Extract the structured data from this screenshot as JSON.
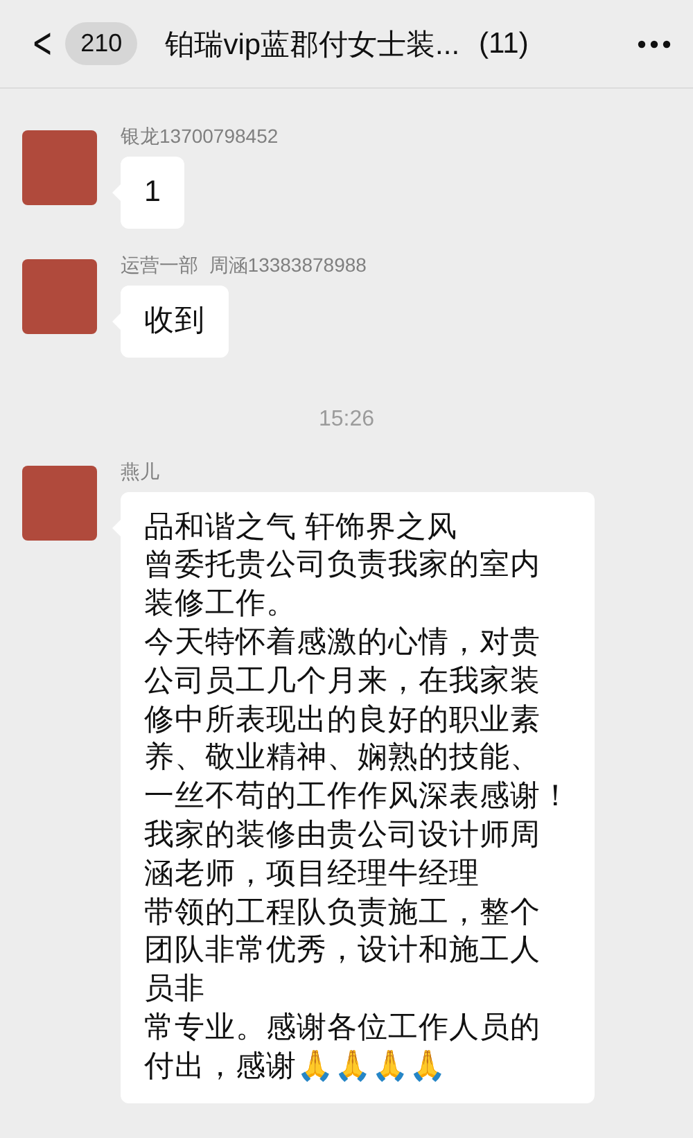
{
  "header": {
    "back_icon": "<",
    "unread_count": "210",
    "title": "铂瑞vip蓝郡付女士装...",
    "member_count": "(11)"
  },
  "items": [
    {
      "kind": "message",
      "sender": "银龙13700798452",
      "lines": [
        "1"
      ]
    },
    {
      "kind": "message",
      "sender": "运营一部  周涵13383878988",
      "lines": [
        "收到"
      ]
    },
    {
      "kind": "time",
      "text": "15:26"
    },
    {
      "kind": "message",
      "sender": "燕儿",
      "lines": [
        "品和谐之气 轩饰界之风",
        "曾委托贵公司负责我家的室内",
        "装修工作。",
        "今天特怀着感激的心情，对贵",
        "公司员工几个月来，在我家装",
        "修中所表现出的良好的职业素",
        "养、敬业精神、娴熟的技能、",
        "一丝不苟的工作作风深表感谢！",
        "我家的装修由贵公司设计师周",
        "涵老师，项目经理牛经理",
        "带领的工程队负责施工，整个",
        "团队非常优秀，设计和施工人",
        "员非",
        "常专业。感谢各位工作人员的",
        "付出，感谢🙏🙏🙏🙏"
      ]
    }
  ]
}
